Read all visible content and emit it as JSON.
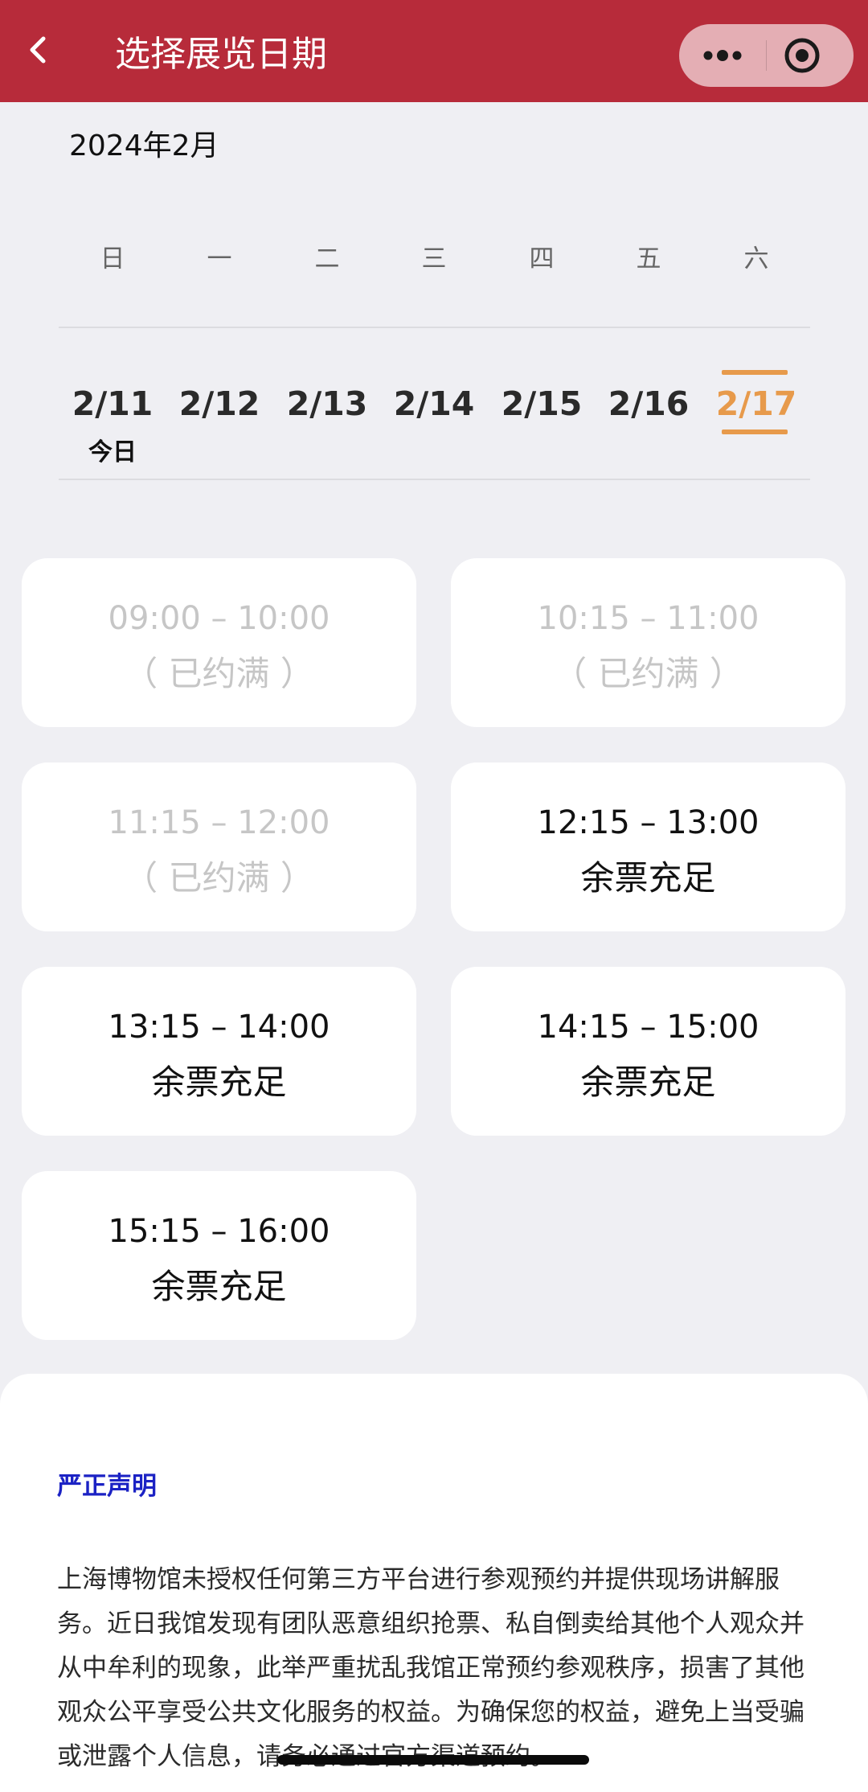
{
  "header": {
    "title": "选择展览日期",
    "back_icon": "chevron-left-icon",
    "more_icon": "more-dots-icon",
    "close_icon": "target-circle-icon",
    "background_color": "#b72b3a"
  },
  "calendar": {
    "month": "2024年2月",
    "weekdays": [
      "日",
      "一",
      "二",
      "三",
      "四",
      "五",
      "六"
    ],
    "dates": [
      "2/11",
      "2/12",
      "2/13",
      "2/14",
      "2/15",
      "2/16",
      "2/17"
    ],
    "today_label": "今日",
    "selected_date": "2/17",
    "selected_color": "#e79a4b"
  },
  "slots": [
    {
      "time": "09:00 – 10:00",
      "status": "（ 已约满 ）",
      "available": false
    },
    {
      "time": "10:15 – 11:00",
      "status": "（ 已约满 ）",
      "available": false
    },
    {
      "time": "11:15 – 12:00",
      "status": "（ 已约满 ）",
      "available": false
    },
    {
      "time": "12:15 – 13:00",
      "status": "余票充足",
      "available": true
    },
    {
      "time": "13:15 – 14:00",
      "status": "余票充足",
      "available": true
    },
    {
      "time": "14:15 – 15:00",
      "status": "余票充足",
      "available": true
    },
    {
      "time": "15:15 – 16:00",
      "status": "余票充足",
      "available": true
    }
  ],
  "notice": {
    "title": "严正声明",
    "body": "上海博物馆未授权任何第三方平台进行参观预约并提供现场讲解服务。近日我馆发现有团队恶意组织抢票、私自倒卖给其他个人观众并从中牟利的现象，此举严重扰乱我馆正常预约参观秩序，损害了其他观众公平享受公共文化服务的权益。为确保您的权益，避免上当受骗或泄露个人信息，请务必通过官方渠道预约。",
    "title_color": "#1b22c4"
  }
}
